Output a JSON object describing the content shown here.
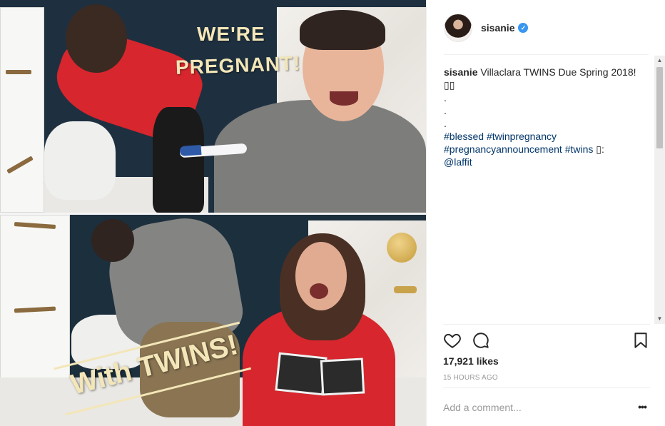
{
  "post": {
    "image_alt": "Couple twin pregnancy announcement collage",
    "overlay": {
      "line1": "WE'RE",
      "line2": "PREGNANT!",
      "twins": "With TWINS!"
    }
  },
  "header": {
    "username": "sisanie",
    "verified_mark": "✓",
    "avatar_icon": "profile-photo"
  },
  "caption": {
    "username": "sisanie",
    "text": "Villaclara TWINS Due Spring 2018!",
    "emoji_line": "▯▯",
    "dots": [
      ".",
      ".",
      "."
    ],
    "hashtag_blessed": "#blessed",
    "hashtag_twinpregnancy": "#twinpregnancy",
    "hashtag_announcement": "#pregnancyannouncement",
    "hashtag_twins": "#twins",
    "camera_glyph": "▯:",
    "mention": "@laffit"
  },
  "actions": {
    "like_icon": "heart-icon",
    "comment_icon": "comment-bubble-icon",
    "save_icon": "bookmark-icon"
  },
  "likes": "17,921 likes",
  "timestamp": "15 HOURS AGO",
  "comment": {
    "placeholder": "Add a comment...",
    "more_label": "•••"
  },
  "scrollbar": {
    "up": "▲",
    "down": "▼"
  },
  "colors": {
    "link": "#003569",
    "verified": "#3897f0",
    "overlay_text": "#f3e6b8",
    "wall": "#1e3040"
  }
}
